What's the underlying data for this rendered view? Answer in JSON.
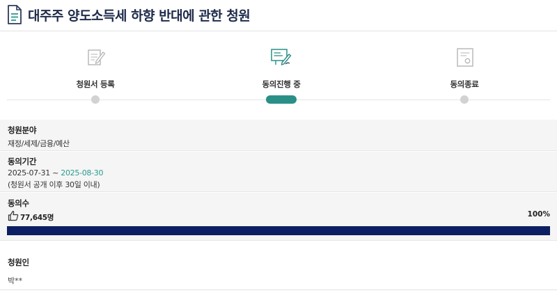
{
  "header": {
    "title": "대주주 양도소득세 하향 반대에 관한 청원",
    "icon": "document-icon"
  },
  "stepper": {
    "steps": [
      {
        "label": "청원서 등록",
        "icon": "write-document-icon",
        "state": "done"
      },
      {
        "label": "동의진행 중",
        "icon": "signing-icon",
        "state": "current"
      },
      {
        "label": "동의종료",
        "icon": "certificate-icon",
        "state": "pending"
      }
    ],
    "active_color": "#2a8f87",
    "inactive_color": "#d2d2d2"
  },
  "category": {
    "heading": "청원분야",
    "value": "재정/세제/금융/예산"
  },
  "period": {
    "heading": "동의기간",
    "start": "2025-07-31",
    "separator": " ~ ",
    "end": "2025-08-30",
    "note": "(청원서 공개 이후 30일 이내)",
    "end_color": "#2a9a90"
  },
  "agreement": {
    "heading": "동의수",
    "count": "77,645명",
    "percent_label": "100%",
    "progress": 1.0,
    "bar_color": "#0d1f63",
    "icon": "thumbs-up-icon"
  },
  "petitioner": {
    "heading": "청원인",
    "value": "박**"
  }
}
